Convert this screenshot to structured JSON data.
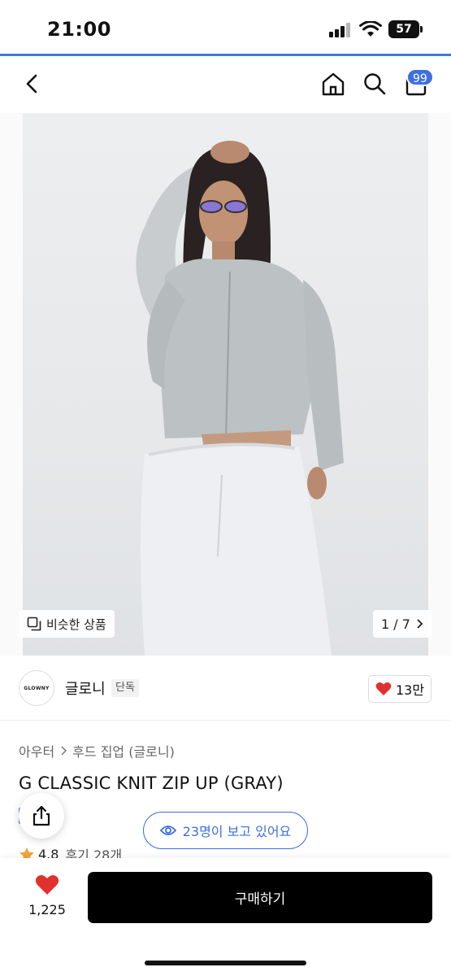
{
  "status_bar": {
    "time": "21:00",
    "battery": "57"
  },
  "nav": {
    "cart_badge": "99",
    "icons": [
      "back-icon",
      "home-icon",
      "search-icon",
      "cart-icon"
    ]
  },
  "hero": {
    "similar_label": "비슷한 상품",
    "image_counter": "1 / 7"
  },
  "brand": {
    "logo_text": "GLOWNY",
    "name": "글로니",
    "tag": "단독",
    "likes": "13만"
  },
  "product": {
    "breadcrumb": [
      "아우터",
      "후드 집업 (글로니)"
    ],
    "title": "G CLASSIC KNIT ZIP UP (GRAY)",
    "viewers": "23명이 보고 있어요",
    "rating": "4.8",
    "reviews": "후기 28개"
  },
  "bottom": {
    "wish_count": "1,225",
    "buy_label": "구매하기"
  },
  "colors": {
    "accent": "#3d6fe0",
    "heart": "#e0312f",
    "star": "#f2a23a"
  }
}
